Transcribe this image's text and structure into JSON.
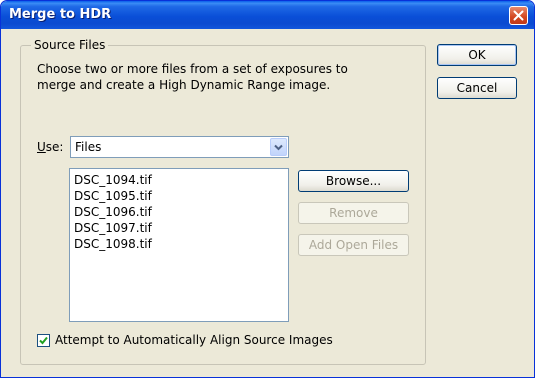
{
  "window": {
    "title": "Merge to HDR"
  },
  "source_files": {
    "legend": "Source Files",
    "description": "Choose two or more files from a set of exposures to merge and create a High Dynamic Range image.",
    "use_label_prefix": "U",
    "use_label_rest": "se:",
    "use_value": "Files",
    "files": [
      "DSC_1094.tif",
      "DSC_1095.tif",
      "DSC_1096.tif",
      "DSC_1097.tif",
      "DSC_1098.tif"
    ]
  },
  "buttons": {
    "ok": "OK",
    "cancel": "Cancel",
    "browse": "Browse...",
    "remove": "Remove",
    "add_open_files": "Add Open Files"
  },
  "align": {
    "label": "Attempt to Automatically Align Source Images",
    "checked": true
  },
  "icons": {
    "close": "close-icon",
    "dropdown": "chevron-down-icon",
    "check": "checkmark-icon"
  },
  "colors": {
    "titlebar": "#0a4fd8",
    "dialog": "#ece9d8",
    "close": "#d2461f"
  }
}
